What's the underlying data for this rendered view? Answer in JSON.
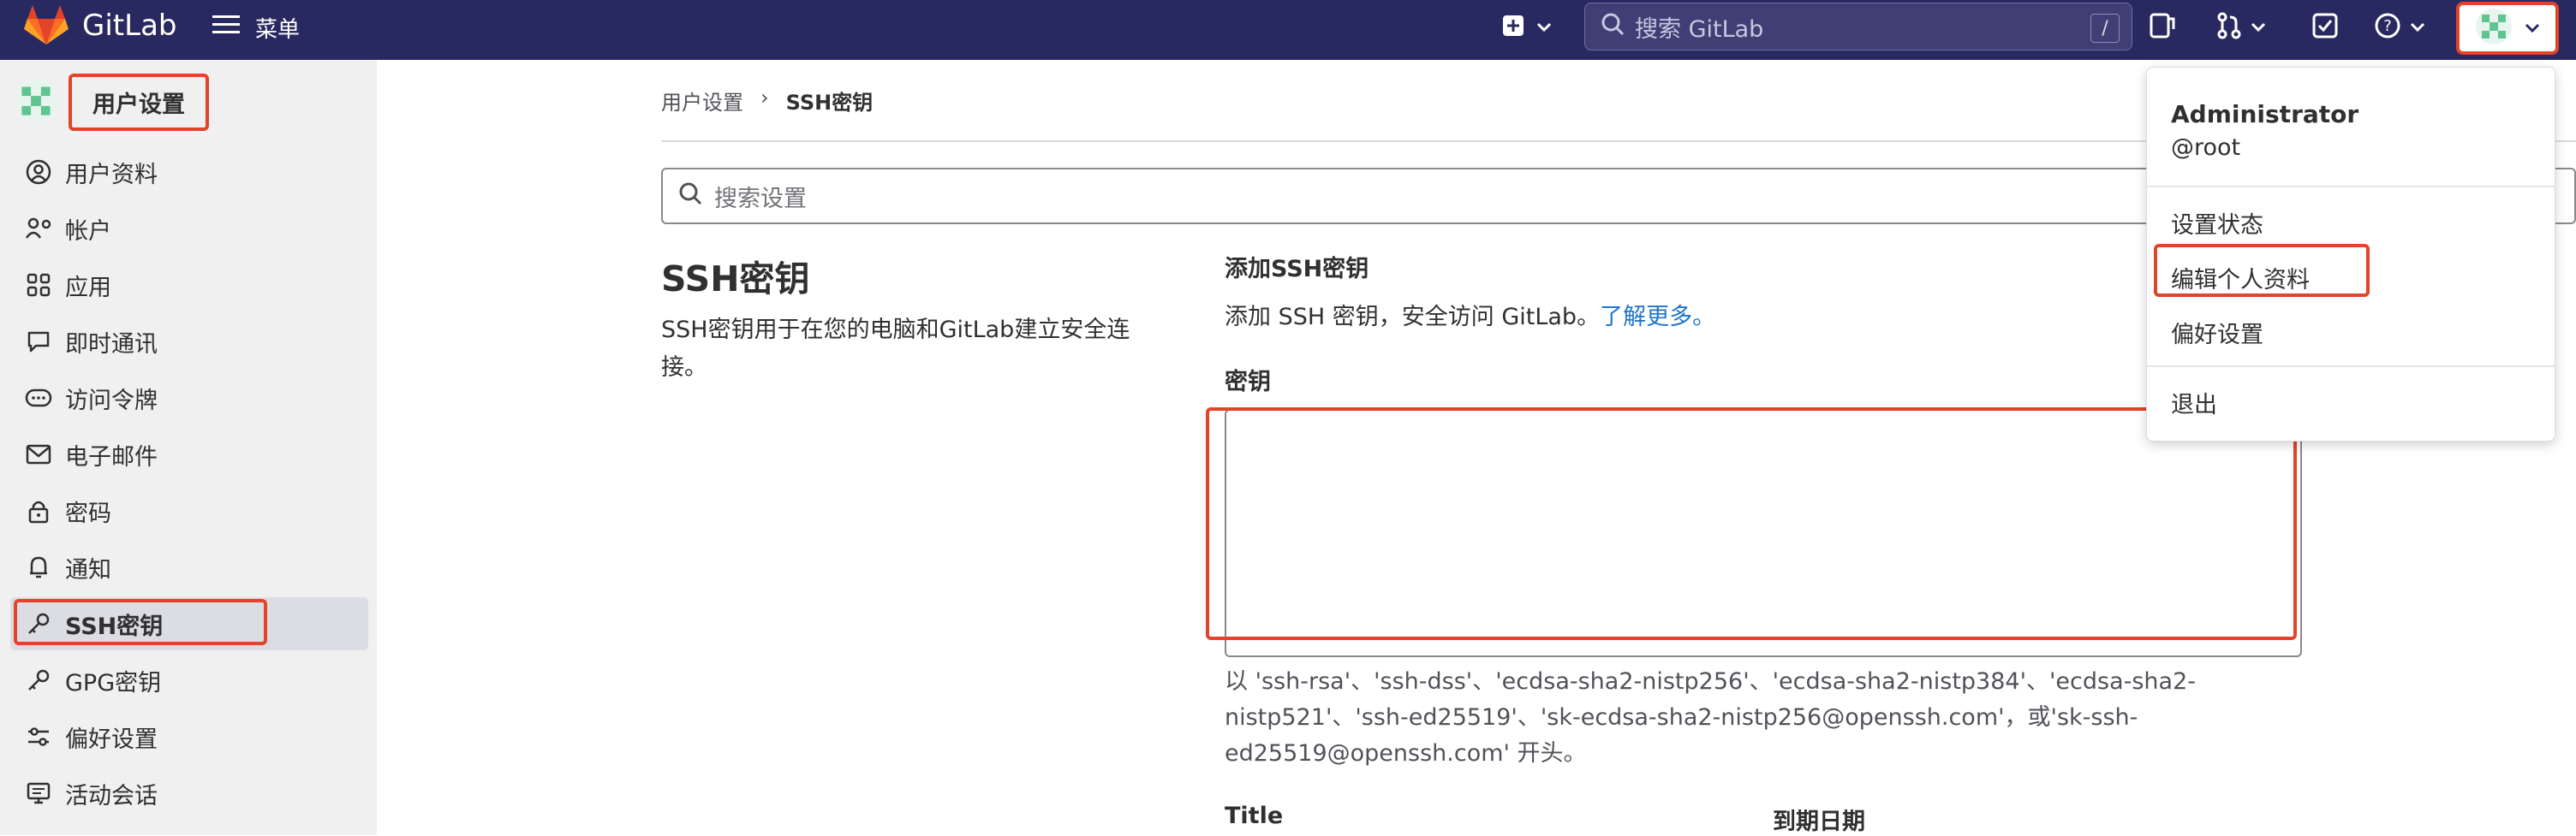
{
  "topbar": {
    "brand": "GitLab",
    "menu_label": "菜单",
    "search_placeholder": "搜索 GitLab",
    "search_shortcut": "/"
  },
  "sidebar": {
    "title": "用户设置",
    "items": [
      {
        "label": "用户资料",
        "icon": "user-circle-icon"
      },
      {
        "label": "帐户",
        "icon": "account-settings-icon"
      },
      {
        "label": "应用",
        "icon": "applications-icon"
      },
      {
        "label": "即时通讯",
        "icon": "chat-bubble-icon"
      },
      {
        "label": "访问令牌",
        "icon": "token-icon"
      },
      {
        "label": "电子邮件",
        "icon": "mail-icon"
      },
      {
        "label": "密码",
        "icon": "lock-icon"
      },
      {
        "label": "通知",
        "icon": "bell-icon"
      },
      {
        "label": "SSH密钥",
        "icon": "key-icon",
        "active": true
      },
      {
        "label": "GPG密钥",
        "icon": "key-icon"
      },
      {
        "label": "偏好设置",
        "icon": "preferences-icon"
      },
      {
        "label": "活动会话",
        "icon": "monitor-icon"
      }
    ]
  },
  "breadcrumb": {
    "parent": "用户设置",
    "current": "SSH密钥"
  },
  "settings_search": {
    "placeholder": "搜索设置"
  },
  "section": {
    "title": "SSH密钥",
    "description": "SSH密钥用于在您的电脑和GitLab建立安全连接。"
  },
  "add_key": {
    "title": "添加SSH密钥",
    "description": "添加 SSH 密钥，安全访问 GitLab。",
    "learn_more": "了解更多。",
    "key_label": "密钥",
    "key_value": "",
    "help": "以 'ssh-rsa'、'ssh-dss'、'ecdsa-sha2-nistp256'、'ecdsa-sha2-nistp384'、'ecdsa-sha2-nistp521'、'ssh-ed25519'、'sk-ecdsa-sha2-nistp256@openssh.com'，或'sk-ssh-ed25519@openssh.com' 开头。",
    "title_label": "Title",
    "expiry_label": "到期日期"
  },
  "user_menu": {
    "name": "Administrator",
    "handle": "@root",
    "items": [
      "设置状态",
      "编辑个人资料",
      "偏好设置",
      "退出"
    ]
  },
  "colors": {
    "topbar": "#292961",
    "highlight": "#e24329",
    "link": "#1f75cb",
    "sidebar_bg": "#f0f0f0"
  }
}
